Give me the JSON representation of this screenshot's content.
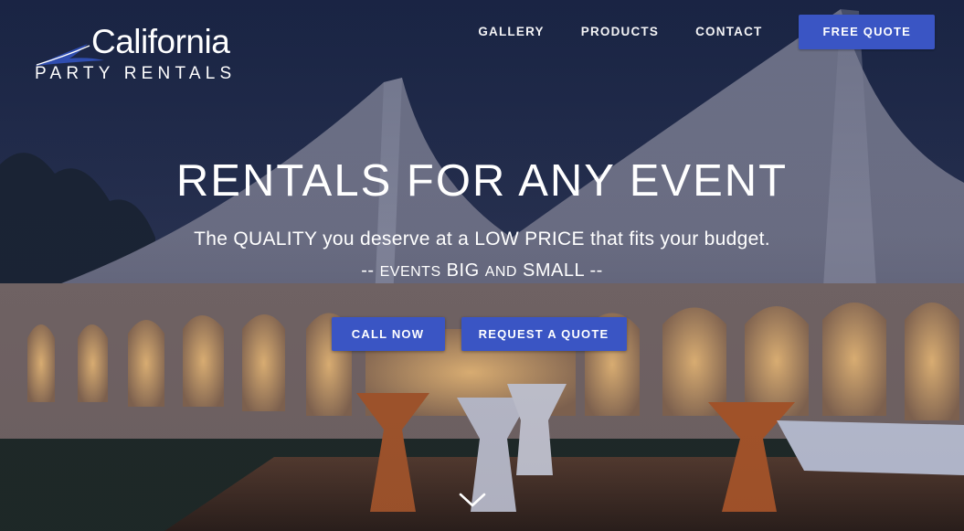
{
  "logo": {
    "name": "California",
    "subtitle": "PARTY RENTALS"
  },
  "nav": {
    "items": [
      "GALLERY",
      "PRODUCTS",
      "CONTACT"
    ],
    "cta_label": "FREE QUOTE"
  },
  "hero": {
    "headline": "RENTALS FOR ANY EVENT",
    "tagline": "The QUALITY you deserve at a LOW PRICE that fits your budget.",
    "subline": {
      "prefix": "-- ",
      "events": "EVENTS",
      "big": " BIG ",
      "and": "AND",
      "small": " SMALL",
      "suffix": " --"
    },
    "buttons": {
      "call": "CALL NOW",
      "request": "REQUEST A QUOTE"
    },
    "scroll_icon": "chevron-down-icon"
  },
  "colors": {
    "accent": "#3a55c4",
    "night": "#1e2a45"
  }
}
